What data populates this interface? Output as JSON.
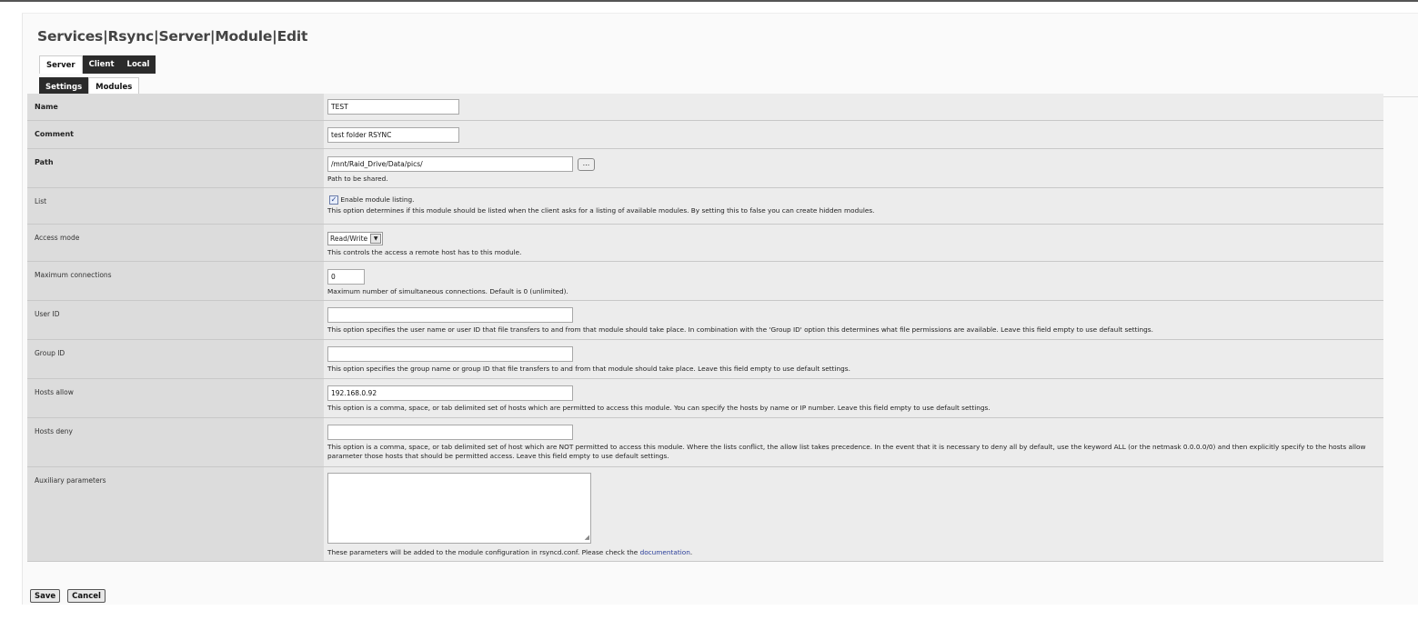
{
  "page": {
    "title": "Services|Rsync|Server|Module|Edit"
  },
  "tabs_primary": [
    {
      "label": "Server",
      "active": true
    },
    {
      "label": "Client",
      "active": false
    },
    {
      "label": "Local",
      "active": false
    }
  ],
  "tabs_secondary": [
    {
      "label": "Settings",
      "active": false
    },
    {
      "label": "Modules",
      "active": true
    }
  ],
  "form": {
    "name": {
      "label": "Name",
      "value": "TEST"
    },
    "comment": {
      "label": "Comment",
      "value": "test folder RSYNC"
    },
    "path": {
      "label": "Path",
      "value": "/mnt/Raid_Drive/Data/pics/",
      "browse_label": "...",
      "description": "Path to be shared."
    },
    "list": {
      "label": "List",
      "checked": true,
      "checkbox_label": "Enable module listing.",
      "description": "This option determines if this module should be listed when the client asks for a listing of available modules. By setting this to false you can create hidden modules."
    },
    "access_mode": {
      "label": "Access mode",
      "value": "Read/Write",
      "description": "This controls the access a remote host has to this module."
    },
    "max_connections": {
      "label": "Maximum connections",
      "value": "0",
      "description": "Maximum number of simultaneous connections. Default is 0 (unlimited)."
    },
    "user_id": {
      "label": "User ID",
      "value": "",
      "description": "This option specifies the user name or user ID that file transfers to and from that module should take place. In combination with the 'Group ID' option this determines what file permissions are available. Leave this field empty to use default settings."
    },
    "group_id": {
      "label": "Group ID",
      "value": "",
      "description": "This option specifies the group name or group ID that file transfers to and from that module should take place. Leave this field empty to use default settings."
    },
    "hosts_allow": {
      "label": "Hosts allow",
      "value": "192.168.0.92",
      "description": "This option is a comma, space, or tab delimited set of hosts which are permitted to access this module. You can specify the hosts by name or IP number. Leave this field empty to use default settings."
    },
    "hosts_deny": {
      "label": "Hosts deny",
      "value": "",
      "description": "This option is a comma, space, or tab delimited set of host which are NOT permitted to access this module. Where the lists conflict, the allow list takes precedence. In the event that it is necessary to deny all by default, use the keyword ALL (or the netmask 0.0.0.0/0) and then explicitly specify to the hosts allow parameter those hosts that should be permitted access. Leave this field empty to use default settings."
    },
    "aux_params": {
      "label": "Auxiliary parameters",
      "value": "",
      "description_prefix": "These parameters will be added to the module configuration in rsyncd.conf. Please check the ",
      "link_text": "documentation",
      "description_suffix": "."
    }
  },
  "buttons": {
    "save": "Save",
    "cancel": "Cancel"
  }
}
